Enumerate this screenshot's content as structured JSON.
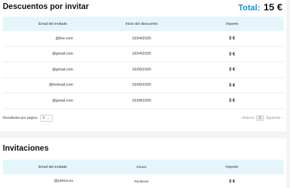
{
  "pending": {
    "title": "Descuentos por invitar",
    "total_label": "Total:",
    "total_value": "15 €",
    "columns": [
      "Email del invitado",
      "Inicio del descuento",
      "Importe"
    ],
    "rows": [
      {
        "email": "@live.com",
        "date": "16/04/2025",
        "amount": "3 €"
      },
      {
        "email": "@gmail.com",
        "date": "16/04/2025",
        "amount": "3 €"
      },
      {
        "email": "@gmail.com",
        "date": "16/05/2025",
        "amount": "3 €"
      },
      {
        "email": "@hotmail.com",
        "date": "16/06/2025",
        "amount": "3 €"
      },
      {
        "email": "@gmail.com",
        "date": "16/08/2025",
        "amount": "3 €"
      }
    ],
    "per_page_label": "Resultados por página",
    "per_page_value": "6",
    "prev_label": "‹ Anterior",
    "page": "1",
    "next_label": "Siguiente ›"
  },
  "invitations": {
    "title": "Invitaciones",
    "columns": [
      "Email del invitado",
      "Estado",
      "Importe"
    ],
    "rows": [
      {
        "email": "@yahoo.es",
        "status": "Pendiente",
        "amount": "3 €"
      }
    ]
  }
}
